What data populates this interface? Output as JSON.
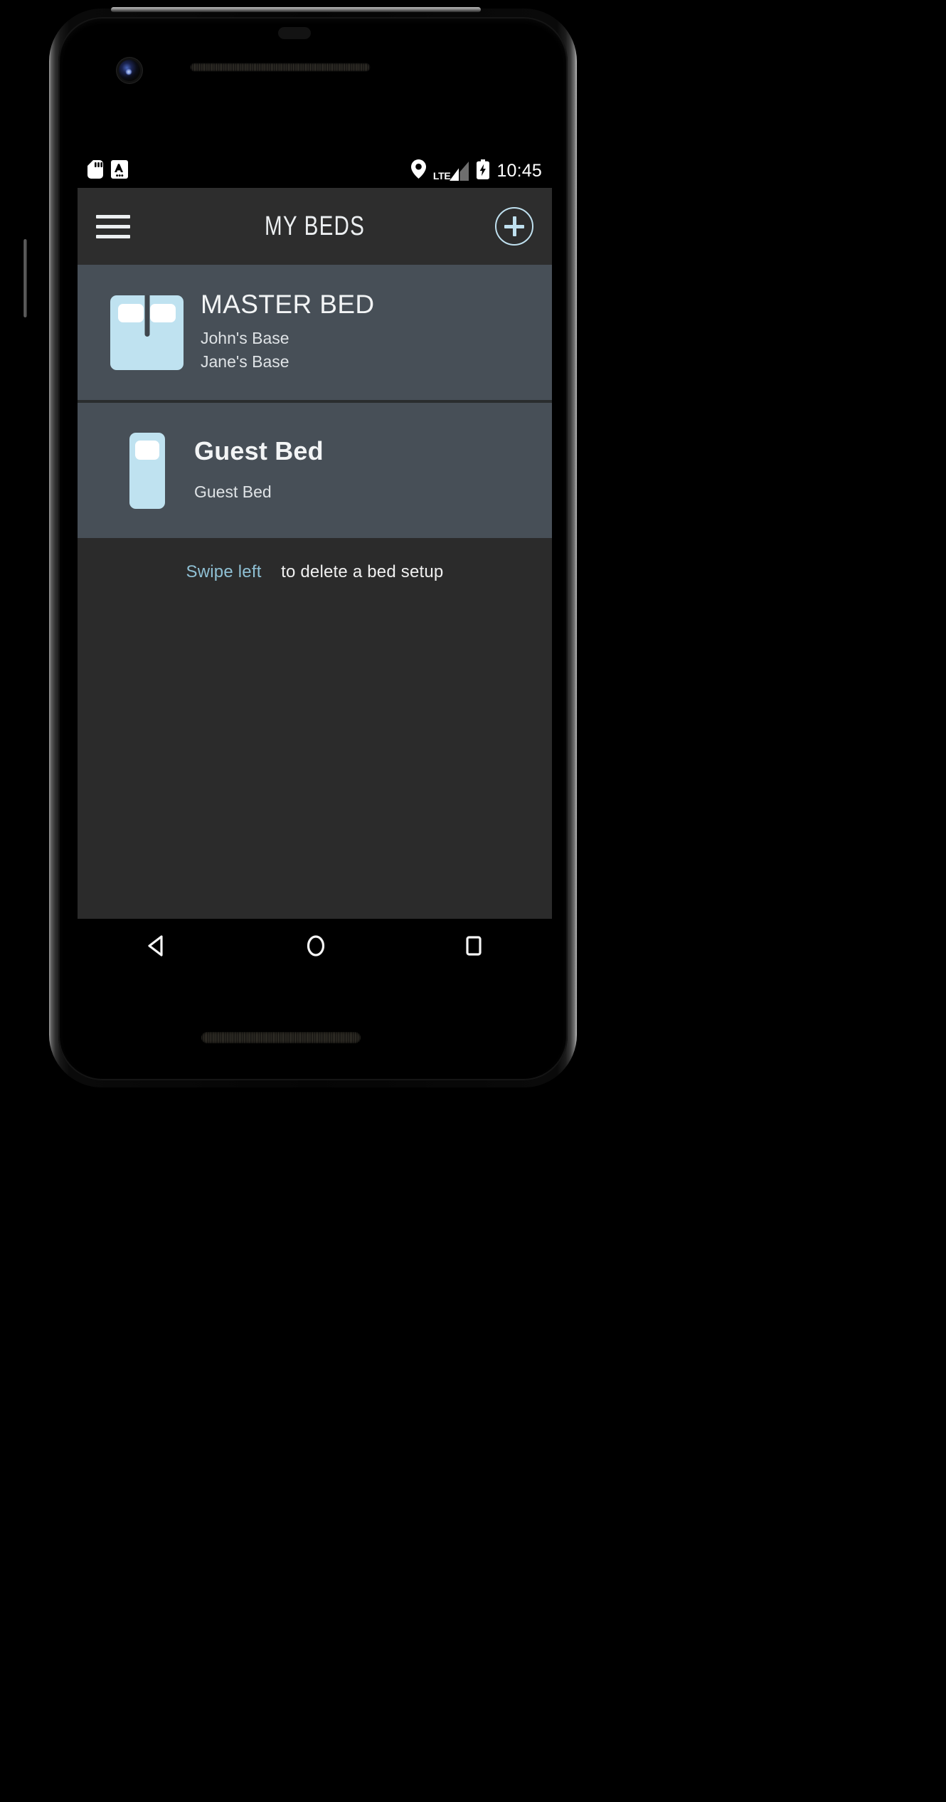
{
  "status_bar": {
    "icons_left": [
      "sd-card-icon",
      "auto-caps-icon"
    ],
    "icons_right": [
      "location-pin-icon",
      "lte-signal-icon",
      "battery-charging-icon"
    ],
    "network_label": "LTE",
    "time": "10:45"
  },
  "app_bar": {
    "menu_icon": "hamburger-menu-icon",
    "title": "MY BEDS",
    "add_icon": "plus-circle-icon"
  },
  "beds": [
    {
      "icon": "double-bed-icon",
      "name": "MASTER BED",
      "bases": [
        "John's Base",
        "Jane's Base"
      ]
    },
    {
      "icon": "single-bed-icon",
      "name": "Guest Bed",
      "bases": [
        "Guest Bed"
      ]
    }
  ],
  "hint": {
    "accent_text": "Swipe left",
    "rest_text": "to delete a bed setup"
  },
  "nav_bar": {
    "back": "back-triangle-icon",
    "home": "home-circle-icon",
    "recents": "recents-square-icon"
  },
  "colors": {
    "accent": "#bfe0ef",
    "row_bg": "#474f57",
    "screen_bg": "#2b2b2b",
    "appbar_bg": "#2d2d2d",
    "bed_icon": "#bfe2f0"
  }
}
